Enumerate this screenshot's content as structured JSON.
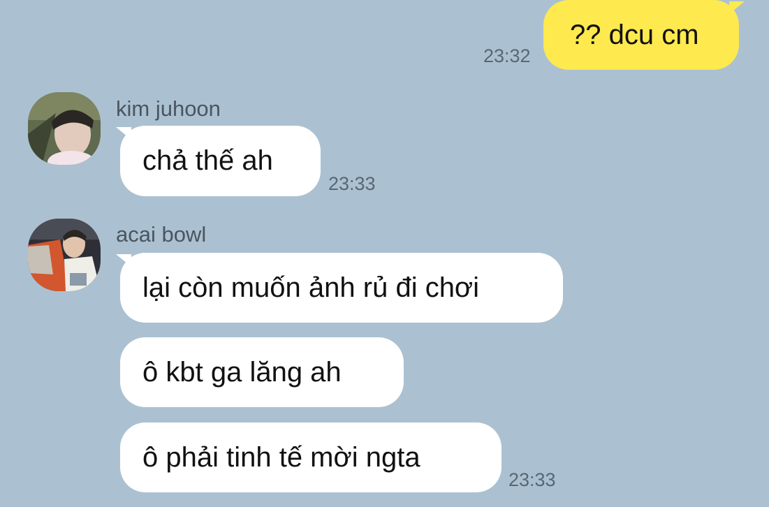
{
  "outgoing": {
    "text": "?? dcu cm",
    "time": "23:32"
  },
  "group1": {
    "sender": "kim juhoon",
    "avatar_icon": "profile-photo-icon",
    "messages": [
      {
        "text": "chả thế ah"
      }
    ],
    "time": "23:33"
  },
  "group2": {
    "sender": "acai bowl",
    "avatar_icon": "profile-photo-icon",
    "messages": [
      {
        "text": "lại còn muốn ảnh rủ đi chơi"
      },
      {
        "text": "ô kbt ga lăng ah"
      },
      {
        "text": "ô phải tinh tế mời ngta"
      }
    ],
    "time": "23:33"
  },
  "colors": {
    "background": "#abc1d1",
    "outgoing_bubble": "#fee94f",
    "incoming_bubble": "#ffffff",
    "timestamp": "#596774",
    "sender_name": "#4b5560"
  }
}
